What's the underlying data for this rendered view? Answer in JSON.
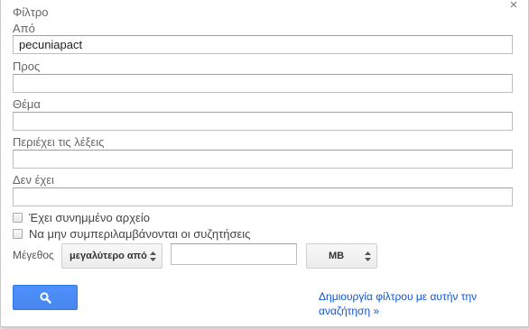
{
  "dialog": {
    "title": "Φίλτρο",
    "close_icon": "close-icon",
    "fields": [
      {
        "label": "Από",
        "value": "pecuniapact"
      },
      {
        "label": "Προς",
        "value": ""
      },
      {
        "label": "Θέμα",
        "value": ""
      },
      {
        "label": "Περιέχει τις λέξεις",
        "value": ""
      },
      {
        "label": "Δεν έχει",
        "value": ""
      }
    ],
    "checkboxes": [
      {
        "label": "Έχει συνημμένο αρχείο",
        "checked": false
      },
      {
        "label": "Να μην συμπεριλαμβάνονται οι συζητήσεις",
        "checked": false
      }
    ],
    "size": {
      "label": "Μέγεθος",
      "comparator": "μεγαλύτερο από",
      "value": "",
      "unit": "MB"
    },
    "search_button": {
      "icon": "search-icon",
      "color": "#4d90fe"
    },
    "create_filter_link": "Δημιουργία φίλτρου με αυτήν την αναζήτηση »",
    "link_color": "#1155cc"
  }
}
